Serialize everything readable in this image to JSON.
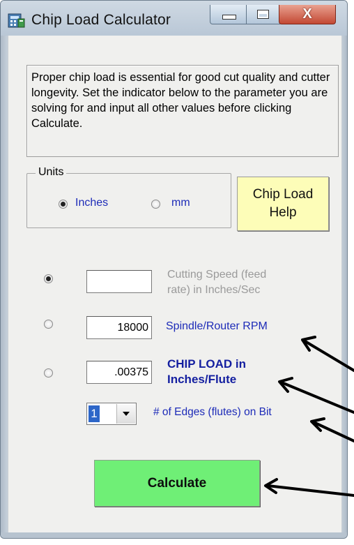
{
  "window": {
    "title": "Chip Load Calculator",
    "close_glyph": "X",
    "icons": [
      "app-calculator-icon",
      "minimize-icon",
      "maximize-icon",
      "close-icon"
    ]
  },
  "info": {
    "text": "Proper chip load is essential for good cut quality and cutter longevity. Set the indicator below to the parameter you are solving for and input all other values before clicking Calculate."
  },
  "units": {
    "group_label": "Units",
    "inches_label": "Inches",
    "mm_label": "mm",
    "selected": "Inches"
  },
  "help_button": {
    "line1": "Chip Load",
    "line2": "Help"
  },
  "cutting_speed": {
    "value": "",
    "label_line1": "Cutting Speed (feed",
    "label_line2": "rate) in Inches/Sec",
    "selected": true
  },
  "spindle_rpm": {
    "value": "18000",
    "label": "Spindle/Router RPM",
    "selected": false
  },
  "chip_load": {
    "value": ".00375",
    "label_line1": "CHIP LOAD in",
    "label_line2": "Inches/Flute",
    "selected": false
  },
  "edges": {
    "selected_value": "1",
    "label": "# of Edges (flutes) on Bit"
  },
  "calculate_button": {
    "label": "Calculate"
  },
  "colors": {
    "label_blue": "#1d2bb8",
    "help_bg": "#fdfdb8",
    "calculate_bg": "#6fef76",
    "close_red": "#c34833"
  }
}
